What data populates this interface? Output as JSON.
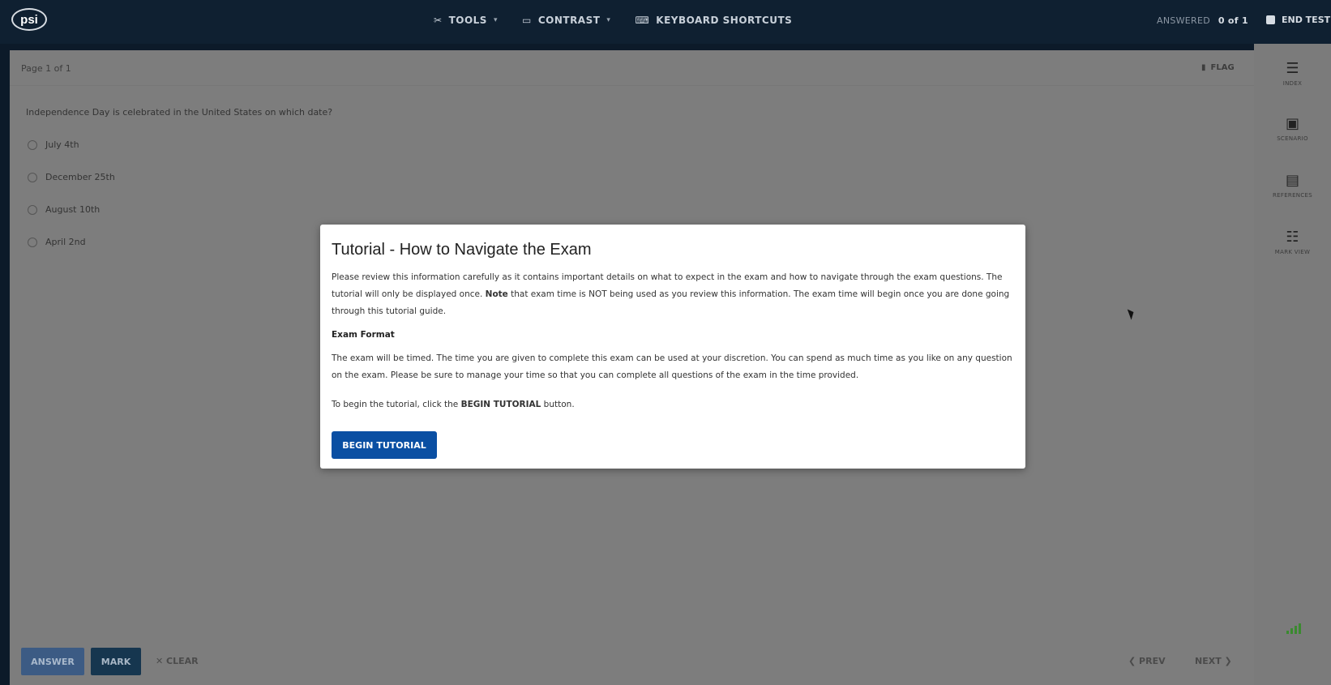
{
  "topbar": {
    "logo": "psi",
    "menu": [
      {
        "label": "TOOLS",
        "icon": "tools-icon",
        "caret": "▾"
      },
      {
        "label": "CONTRAST",
        "icon": "monitor-icon",
        "caret": "▾"
      },
      {
        "label": "KEYBOARD SHORTCUTS",
        "icon": "keyboard-icon",
        "caret": ""
      }
    ],
    "answered_label": "ANSWERED",
    "answered_value": "0 of 1",
    "end_test": "END TEST"
  },
  "main": {
    "page_info": "Page 1 of 1",
    "flag": "FLAG",
    "question": "Independence Day is celebrated in the United States on which date?",
    "options": [
      "July 4th",
      "December 25th",
      "August 10th",
      "April 2nd"
    ]
  },
  "footer": {
    "answer": "ANSWER",
    "mark": "MARK",
    "clear": "✕  CLEAR",
    "prev": "❮  PREV",
    "next": "NEXT  ❯"
  },
  "sidebar": [
    {
      "label": "INDEX",
      "icon": "menu-icon"
    },
    {
      "label": "SCENARIO",
      "icon": "scenario-icon"
    },
    {
      "label": "REFERENCES",
      "icon": "book-icon"
    },
    {
      "label": "MARK VIEW",
      "icon": "list-icon"
    }
  ],
  "modal": {
    "title": "Tutorial - How to Navigate the Exam",
    "intro_a": "Please review this information carefully as it contains important details on what to expect in the exam and how to navigate through the exam questions. The tutorial will only be displayed once. ",
    "intro_bold": "Note",
    "intro_b": " that exam time is NOT being used as you review this information. The exam time will begin once you are done going through this tutorial guide.",
    "section_heading": "Exam Format",
    "section_text": "The exam will be timed. The time you are given to complete this exam can be used at your discretion. You can spend as much time as you like on any question on the exam. Please be sure to manage your time so that you can complete all questions of the exam in the time provided.",
    "begin_a": "To begin the tutorial, click the ",
    "begin_bold": "BEGIN TUTORIAL",
    "begin_b": " button.",
    "button": "BEGIN TUTORIAL"
  },
  "colors": {
    "topbar": "#0f2031",
    "primary_button": "#0a4fa3",
    "overlay": "#7d7d7d"
  }
}
